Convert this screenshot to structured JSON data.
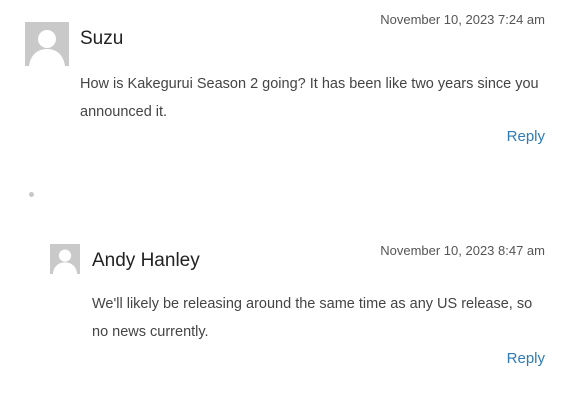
{
  "comments": [
    {
      "author": "Suzu",
      "date": "November 10, 2023 7:24 am",
      "text": "How is Kakegurui Season 2 going? It has been like two years since you announced it.",
      "reply_label": "Reply",
      "avatar_icon": "default-avatar-icon"
    },
    {
      "author": "Andy Hanley",
      "date": "November 10, 2023 8:47 am",
      "text": "We'll likely be releasing around the same time as any US release, so no news currently.",
      "reply_label": "Reply",
      "avatar_icon": "default-avatar-icon"
    }
  ],
  "colors": {
    "link": "#2e7bb7",
    "avatar_bg": "#c9c9c9"
  }
}
